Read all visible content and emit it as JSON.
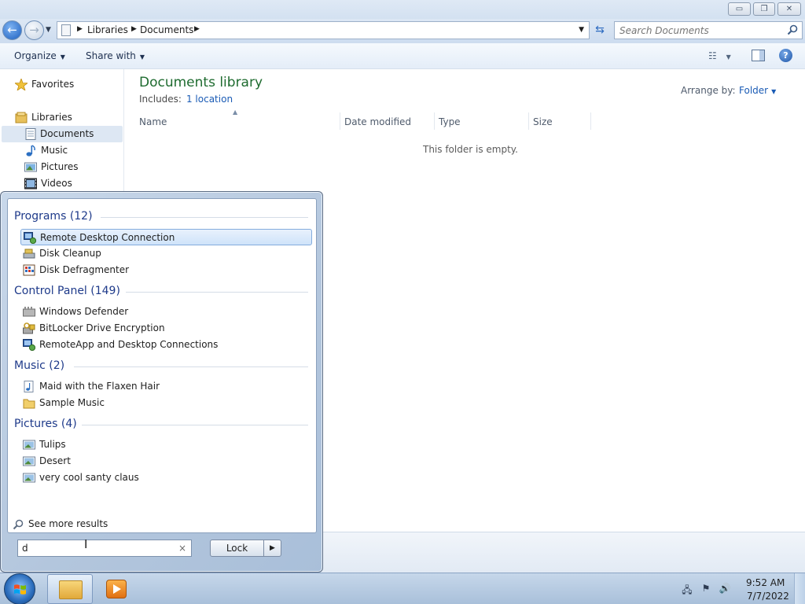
{
  "window": {
    "buttons": {
      "minimize": "▭",
      "maximize": "❐",
      "close": "✕"
    }
  },
  "address": {
    "crumbs": [
      "Libraries",
      "Documents"
    ],
    "search_placeholder": "Search Documents"
  },
  "toolbar": {
    "organize_label": "Organize",
    "share_label": "Share with"
  },
  "navigation": {
    "favorites": "Favorites",
    "libraries": "Libraries",
    "items": [
      {
        "label": "Documents",
        "icon": "documents-icon",
        "selected": true
      },
      {
        "label": "Music",
        "icon": "music-icon"
      },
      {
        "label": "Pictures",
        "icon": "pictures-icon"
      },
      {
        "label": "Videos",
        "icon": "videos-icon"
      }
    ]
  },
  "library": {
    "title": "Documents library",
    "includes_label": "Includes:",
    "includes_link": "1 location",
    "arrange_label": "Arrange by:",
    "arrange_value": "Folder",
    "columns": [
      "Name",
      "Date modified",
      "Type",
      "Size"
    ],
    "empty_message": "This folder is empty."
  },
  "start_menu": {
    "groups": [
      {
        "title": "Programs (12)",
        "items": [
          "Remote Desktop Connection",
          "Disk Cleanup",
          "Disk Defragmenter"
        ]
      },
      {
        "title": "Control Panel (149)",
        "items": [
          "Windows Defender",
          "BitLocker Drive Encryption",
          "RemoteApp and Desktop Connections"
        ]
      },
      {
        "title": "Music (2)",
        "items": [
          "Maid with the Flaxen Hair",
          "Sample Music"
        ]
      },
      {
        "title": "Pictures (4)",
        "items": [
          "Tulips",
          "Desert",
          "very cool santy claus"
        ]
      }
    ],
    "selected_item": "Remote Desktop Connection",
    "see_more": "See more results",
    "search_value": "d",
    "clear_glyph": "×",
    "lock_label": "Lock",
    "lock_arrow": "▶"
  },
  "taskbar": {
    "time": "9:52 AM",
    "date": "7/7/2022"
  },
  "colors": {
    "library_title": "#1e6b2f",
    "link": "#1a5bb5",
    "group_title": "#1e3a8a",
    "selection": "#cfe3fa"
  }
}
